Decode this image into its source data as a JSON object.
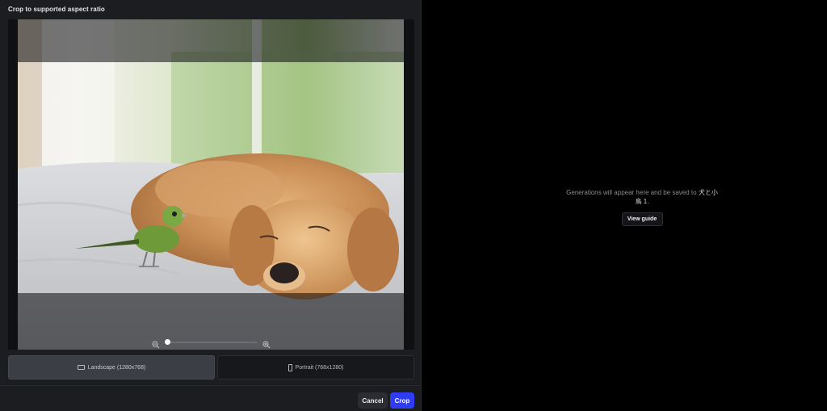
{
  "crop_modal": {
    "title": "Crop to supported aspect ratio",
    "options": [
      {
        "label": "Landscape (1280x768)",
        "icon": "landscape-icon",
        "selected": true
      },
      {
        "label": "Portrait (768x1280)",
        "icon": "portrait-icon",
        "selected": false
      }
    ],
    "zoom": {
      "level": 0,
      "min_icon": "zoom-out-icon",
      "max_icon": "zoom-in-icon"
    },
    "cancel_label": "Cancel",
    "crop_label": "Crop"
  },
  "empty_state": {
    "message_prefix": "Generations will appear here and be saved to ",
    "project_name": "犬と小鳥 1",
    "message_suffix": ".",
    "guide_label": "View guide"
  },
  "colors": {
    "accent": "#2f3cf1",
    "panel_bg": "#1c1d21",
    "page_bg": "#000000"
  }
}
